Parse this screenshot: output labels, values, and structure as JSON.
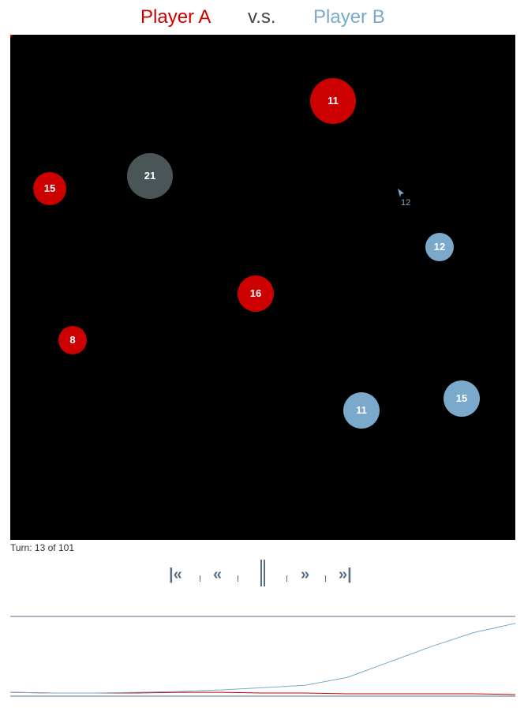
{
  "header": {
    "player_a": "Player A",
    "versus": "v.s.",
    "player_b": "Player B"
  },
  "colors": {
    "player_a": "#cc0000",
    "player_b": "#7aa9cc",
    "neutral": "#4a5557",
    "board_background": "#000000",
    "controls": "#5a6e80"
  },
  "board": {
    "planets": [
      {
        "owner": "player_a",
        "ships": "11"
      },
      {
        "owner": "neutral",
        "ships": "21"
      },
      {
        "owner": "player_a",
        "ships": "15"
      },
      {
        "owner": "player_b",
        "ships": "12"
      },
      {
        "owner": "player_a",
        "ships": "16"
      },
      {
        "owner": "player_a",
        "ships": "8"
      },
      {
        "owner": "player_b",
        "ships": "11"
      },
      {
        "owner": "player_b",
        "ships": "15"
      }
    ],
    "fleets": [
      {
        "owner": "player_b",
        "ships": "12"
      }
    ]
  },
  "turn": {
    "label": "Turn:",
    "current": "13",
    "of_label": "of",
    "total": "101"
  },
  "controls": {
    "first": "|«",
    "previous": "«",
    "pause": "‖",
    "next": "»",
    "last": "»|"
  },
  "chart_data": {
    "type": "line",
    "series": [
      {
        "color": "#cc0000",
        "trend": [
          3,
          2,
          2,
          2,
          3,
          3,
          2,
          2,
          1,
          1,
          1,
          1,
          0
        ]
      },
      {
        "color": "#7aa9cc",
        "trend": [
          3,
          2,
          2,
          3,
          4,
          6,
          9,
          12,
          22,
          42,
          62,
          80,
          92
        ]
      }
    ]
  }
}
